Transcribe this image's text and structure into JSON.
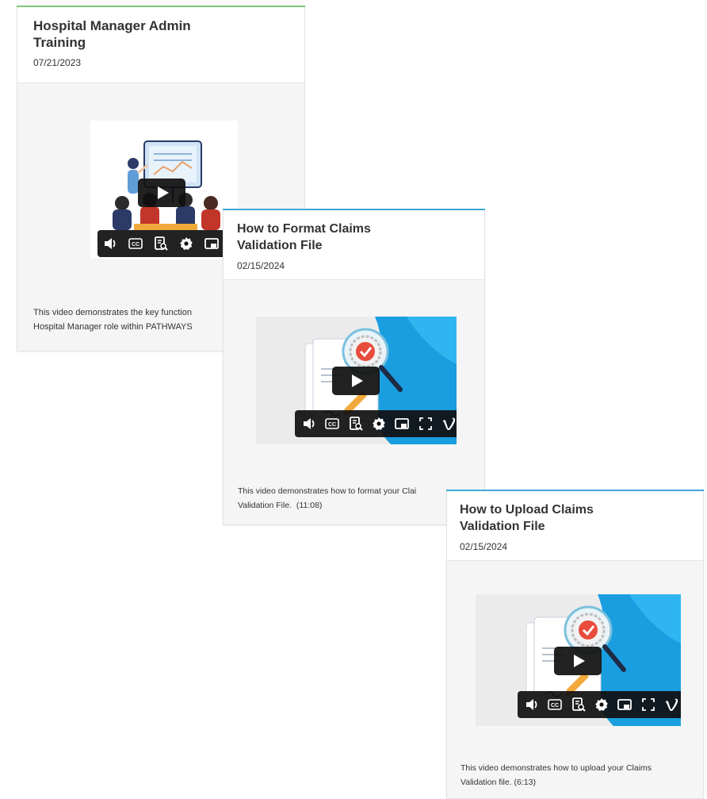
{
  "cards": [
    {
      "title": "Hospital Manager Admin Training",
      "date": "07/21/2023",
      "description": "This video demonstrates the key function\nHospital Manager role within PATHWAYS",
      "accent_color": "#7cc576"
    },
    {
      "title": "How to Format Claims Validation File",
      "date": "02/15/2024",
      "description": "This video demonstrates how to format your Clai\nValidation File.  (11:08)",
      "accent_color": "#3fa8d8"
    },
    {
      "title": "How to Upload Claims Validation File",
      "date": "02/15/2024",
      "description": "This video demonstrates how to upload your Claims\nValidation file. (6:13)",
      "accent_color": "#3fa8d8"
    }
  ],
  "player_controls": [
    "volume-icon",
    "captions-icon",
    "transcript-icon",
    "settings-icon",
    "picture-in-picture-icon",
    "fullscreen-icon",
    "vimeo-logo-icon"
  ]
}
